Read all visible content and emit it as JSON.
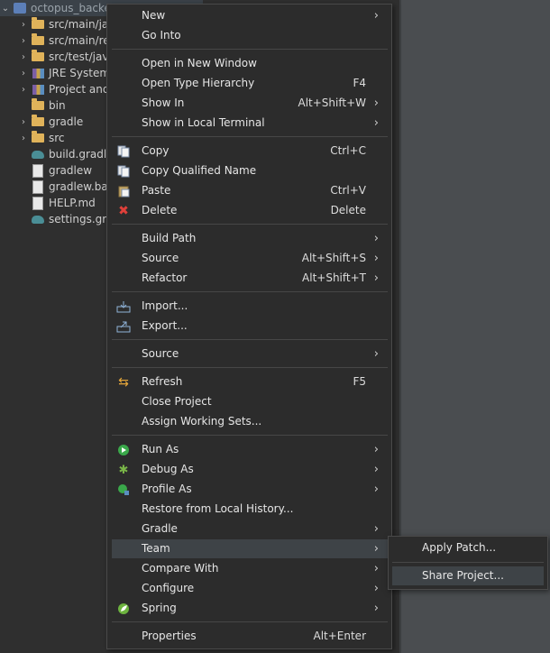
{
  "tree": {
    "root_label": "octopus_backe",
    "items": [
      {
        "label": "src/main/jav",
        "icon": "package-folder-icon"
      },
      {
        "label": "src/main/re",
        "icon": "package-folder-icon"
      },
      {
        "label": "src/test/java",
        "icon": "package-folder-icon"
      },
      {
        "label": "JRE System",
        "icon": "library-icon"
      },
      {
        "label": "Project and",
        "icon": "library-icon"
      },
      {
        "label": "bin",
        "icon": "folder-icon"
      },
      {
        "label": "gradle",
        "icon": "folder-icon"
      },
      {
        "label": "src",
        "icon": "folder-icon"
      },
      {
        "label": "build.gradle",
        "icon": "gradle-icon"
      },
      {
        "label": "gradlew",
        "icon": "file-icon"
      },
      {
        "label": "gradlew.bat",
        "icon": "file-icon"
      },
      {
        "label": "HELP.md",
        "icon": "file-icon"
      },
      {
        "label": "settings.gra",
        "icon": "gradle-icon"
      }
    ]
  },
  "menu": {
    "new": "New",
    "go_into": "Go Into",
    "open_new_window": "Open in New Window",
    "open_type_hierarchy": "Open Type Hierarchy",
    "open_type_hierarchy_acc": "F4",
    "show_in": "Show In",
    "show_in_acc": "Alt+Shift+W",
    "show_in_terminal": "Show in Local Terminal",
    "copy": "Copy",
    "copy_acc": "Ctrl+C",
    "copy_qualified": "Copy Qualified Name",
    "paste": "Paste",
    "paste_acc": "Ctrl+V",
    "delete": "Delete",
    "delete_acc": "Delete",
    "build_path": "Build Path",
    "source1": "Source",
    "source1_acc": "Alt+Shift+S",
    "refactor": "Refactor",
    "refactor_acc": "Alt+Shift+T",
    "import": "Import...",
    "export": "Export...",
    "source2": "Source",
    "refresh": "Refresh",
    "refresh_acc": "F5",
    "close_project": "Close Project",
    "assign_working_sets": "Assign Working Sets...",
    "run_as": "Run As",
    "debug_as": "Debug As",
    "profile_as": "Profile As",
    "restore_history": "Restore from Local History...",
    "gradle": "Gradle",
    "team": "Team",
    "compare_with": "Compare With",
    "configure": "Configure",
    "spring": "Spring",
    "properties": "Properties",
    "properties_acc": "Alt+Enter"
  },
  "submenu": {
    "apply_patch": "Apply Patch...",
    "share_project": "Share Project..."
  }
}
